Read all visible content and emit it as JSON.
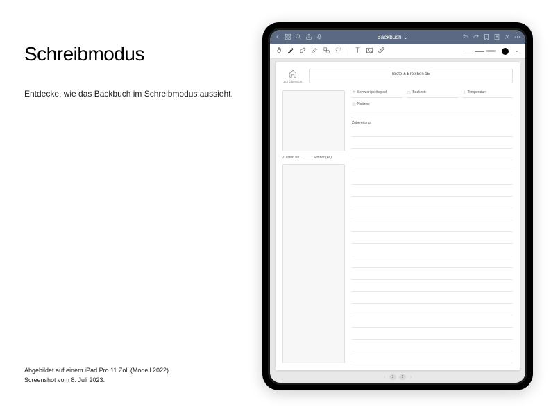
{
  "promo": {
    "title": "Schreibmodus",
    "subtitle": "Entdecke, wie das Backbuch im Schreibmodus aussieht.",
    "footer_line1": "Abgebildet auf einem iPad Pro 11 Zoll (Modell 2022).",
    "footer_line2": "Screenshot vom 8. Juli 2023."
  },
  "app": {
    "doc_title": "Backbuch",
    "chevron": "⌄"
  },
  "page": {
    "home_label": "Zur Übersicht",
    "title": "Brote & Brötchen 15",
    "zutaten_prefix": "Zutaten für",
    "zutaten_suffix": "Portion(en):",
    "meta": {
      "difficulty": "Schwierigkeitsgrad:",
      "baketime": "Backzeit:",
      "temperature": "Temperatur:"
    },
    "notes": "Notizen:",
    "prep": "Zubereitung:"
  },
  "pager": {
    "p1": "1",
    "p2": "2"
  }
}
